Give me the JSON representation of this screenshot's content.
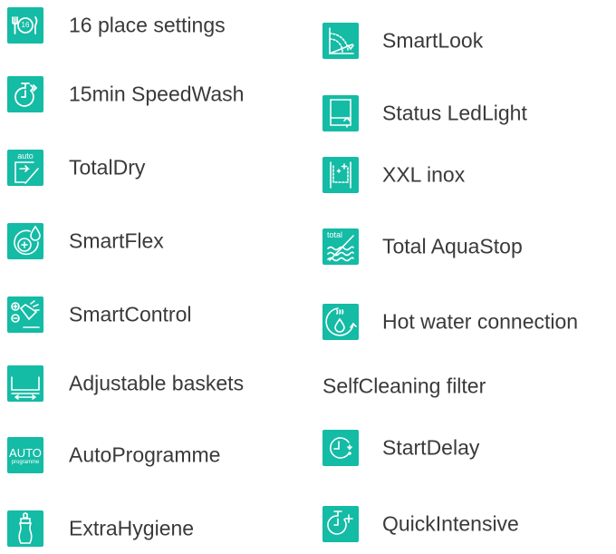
{
  "colors": {
    "accent": "#14bba5",
    "text": "#3a3a3a"
  },
  "left_column": [
    {
      "label": "16 place settings",
      "icon": "place-settings-icon",
      "icon_text": "16"
    },
    {
      "label": "15min SpeedWash",
      "icon": "speedwash-timer-icon"
    },
    {
      "label": "TotalDry",
      "icon": "auto-dry-door-icon",
      "icon_text": "auto"
    },
    {
      "label": "SmartFlex",
      "icon": "smartflex-drop-icon"
    },
    {
      "label": "SmartControl",
      "icon": "smartcontrol-remote-icon"
    },
    {
      "label": "Adjustable baskets",
      "icon": "adjustable-basket-icon"
    },
    {
      "label": "AutoProgramme",
      "icon": "auto-programme-icon",
      "icon_text": "AUTO",
      "icon_subtext": "programme"
    },
    {
      "label": "ExtraHygiene",
      "icon": "baby-bottle-icon"
    }
  ],
  "right_column": [
    {
      "label": "SmartLook",
      "icon": "smartlook-projection-icon"
    },
    {
      "label": "Status LedLight",
      "icon": "status-ledlight-icon"
    },
    {
      "label": "XXL inox",
      "icon": "xxl-inox-tub-icon"
    },
    {
      "label": "Total AquaStop",
      "icon": "total-aquastop-icon",
      "icon_text": "total"
    },
    {
      "label": "Hot water connection",
      "icon": "hot-water-connection-icon"
    },
    {
      "label": "SelfCleaning filter"
    },
    {
      "label": "StartDelay",
      "icon": "start-delay-clock-icon"
    },
    {
      "label": "QuickIntensive",
      "icon": "quick-intensive-timer-icon"
    }
  ]
}
